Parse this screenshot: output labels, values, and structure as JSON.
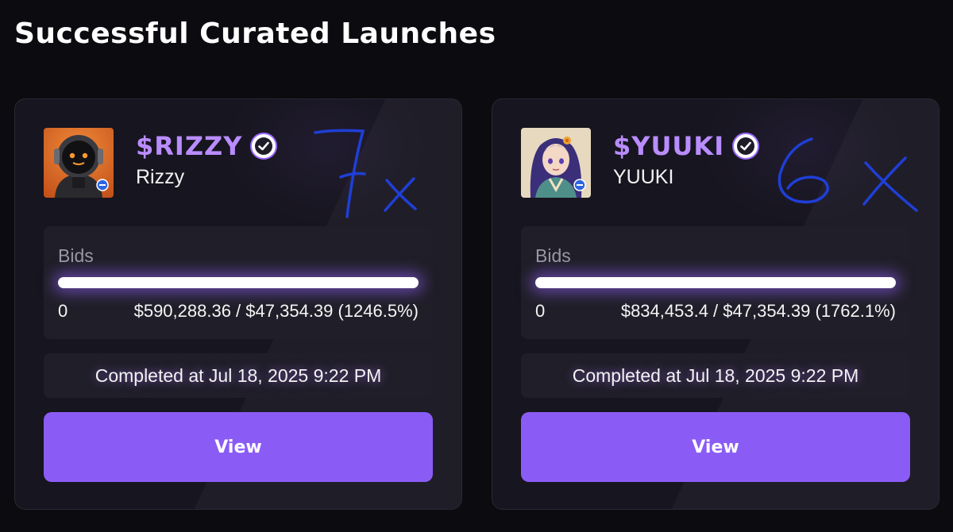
{
  "page": {
    "title": "Successful Curated Launches"
  },
  "cards": [
    {
      "ticker": "$RIZZY",
      "name": "Rizzy",
      "bids_label": "Bids",
      "bid_count": "0",
      "bid_amount": "$590,288.36 / $47,354.39 (1246.5%)",
      "progress_percent": 100,
      "completed": "Completed at Jul 18, 2025 9:22 PM",
      "view_label": "View",
      "annotation": "7x"
    },
    {
      "ticker": "$YUUKI",
      "name": "YUUKI",
      "bids_label": "Bids",
      "bid_count": "0",
      "bid_amount": "$834,453.4 / $47,354.39 (1762.1%)",
      "progress_percent": 100,
      "completed": "Completed at Jul 18, 2025 9:22 PM",
      "view_label": "View",
      "annotation": "6x"
    }
  ],
  "colors": {
    "accent": "#8a5cf5",
    "ticker": "#b98cff",
    "annotation_ink": "#1f3fd6",
    "background": "#0c0b10",
    "card": "#17151f"
  },
  "icons": [
    "verified-check-icon",
    "avatar-robot-image",
    "avatar-anime-girl-image"
  ]
}
